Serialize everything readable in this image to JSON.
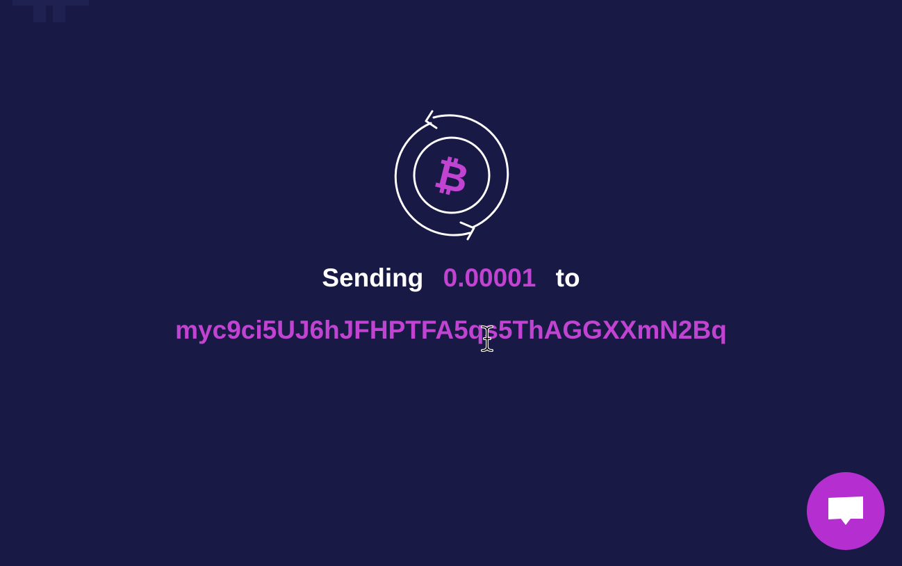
{
  "status": {
    "prefix": "Sending",
    "amount": "0.00001",
    "suffix": "to",
    "address": "myc9ci5UJ6hJFHPTFA5qs5ThAGGXXmN2Bq"
  },
  "icons": {
    "coin": "bitcoin-cash-icon",
    "chat": "chat-bubble-icon",
    "cursor": "text-cursor-icon",
    "logo": "logo-icon"
  },
  "colors": {
    "background": "#181944",
    "accent": "#c043d2",
    "chat_button": "#b52fd0",
    "text": "#ffffff"
  }
}
